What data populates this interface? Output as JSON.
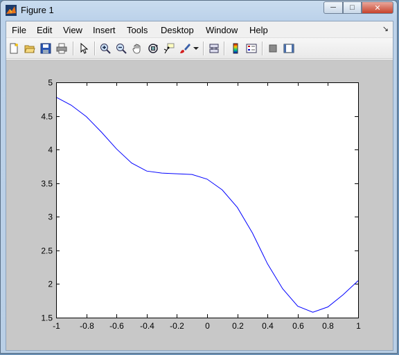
{
  "window": {
    "title": "Figure 1",
    "minimize": "─",
    "maximize": "□",
    "close": "✕"
  },
  "menu": [
    "File",
    "Edit",
    "View",
    "Insert",
    "Tools",
    "Desktop",
    "Window",
    "Help"
  ],
  "toolbar_icons": [
    "new-figure-icon",
    "open-file-icon",
    "save-icon",
    "print-icon",
    "select-arrow-icon",
    "zoom-in-icon",
    "zoom-out-icon",
    "pan-hand-icon",
    "rotate-3d-icon",
    "data-cursor-icon",
    "brush-icon",
    "brush-dropdown-icon",
    "link-plot-icon",
    "colorbar-icon",
    "legend-icon",
    "hide-plot-tools-icon",
    "show-plot-tools-icon"
  ],
  "colors": {
    "line": "#0000ff",
    "figure_bg": "#c8c8c8",
    "axes_bg": "#ffffff"
  },
  "chart_data": {
    "type": "line",
    "title": "",
    "xlabel": "",
    "ylabel": "",
    "xlim": [
      -1,
      1
    ],
    "ylim": [
      1.5,
      5
    ],
    "xticks": [
      "-1",
      "-0.8",
      "-0.6",
      "-0.4",
      "-0.2",
      "0",
      "0.2",
      "0.4",
      "0.6",
      "0.8",
      "1"
    ],
    "yticks": [
      "1.5",
      "2",
      "2.5",
      "3",
      "3.5",
      "4",
      "4.5",
      "5"
    ],
    "grid": false,
    "series": [
      {
        "x": [
          -1,
          -0.9,
          -0.8,
          -0.7,
          -0.6,
          -0.5,
          -0.4,
          -0.3,
          -0.2,
          -0.1,
          0,
          0.1,
          0.2,
          0.3,
          0.4,
          0.5,
          0.6,
          0.7,
          0.8,
          0.9,
          1
        ],
        "values": [
          4.78,
          4.66,
          4.49,
          4.26,
          4.01,
          3.8,
          3.68,
          3.65,
          3.64,
          3.63,
          3.56,
          3.4,
          3.14,
          2.76,
          2.3,
          1.93,
          1.67,
          1.58,
          1.66,
          1.84,
          2.05
        ]
      }
    ]
  }
}
